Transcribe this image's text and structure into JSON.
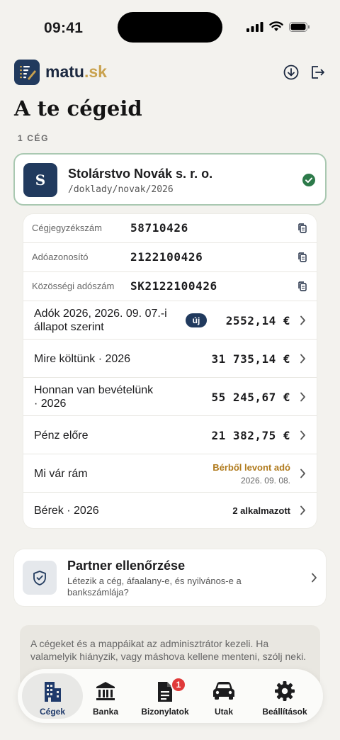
{
  "status_bar": {
    "time": "09:41"
  },
  "app": {
    "brand_name": "matu",
    "brand_tld": ".sk"
  },
  "page": {
    "title": "A te cégeid",
    "count_label": "1 CÉG"
  },
  "company": {
    "initial": "S",
    "name": "Stolárstvo Novák s. r. o.",
    "path": "/doklady/novak/2026",
    "selected": true
  },
  "details": {
    "identifiers": [
      {
        "label": "Cégjegyzékszám",
        "value": "58710426"
      },
      {
        "label": "Adóazonosító",
        "value": "2122100426"
      },
      {
        "label": "Közösségi adószám",
        "value": "SK2122100426"
      }
    ],
    "taxes": {
      "label_line1": "Adók 2026, 2026. 09. 07.-i",
      "label_line2": "állapot szerint",
      "badge": "új",
      "amount": "2552,14 €"
    },
    "spending": {
      "label": "Mire költünk · 2026",
      "amount": "31 735,14 €"
    },
    "income": {
      "label_line1": "Honnan van bevételünk",
      "label_line2": "· 2026",
      "amount": "55 245,67 €"
    },
    "prepaid": {
      "label": "Pénz előre",
      "amount": "21 382,75 €"
    },
    "upcoming": {
      "label": "Mi vár rám",
      "title": "Bérből levont adó",
      "date": "2026. 09. 08."
    },
    "wages": {
      "label": "Bérek · 2026",
      "value": "2 alkalmazott"
    }
  },
  "partner": {
    "title": "Partner ellenőrzése",
    "description": "Létezik a cég, áfaalany-e, és nyilvános-e a bankszámlája?"
  },
  "info": {
    "text": "A cégeket és a mappáikat az adminisztrátor kezeli. Ha valamelyik hiányzik, vagy máshova kellene menteni, szólj neki."
  },
  "tabs": [
    {
      "label": "Cégek",
      "icon": "building-icon",
      "active": true
    },
    {
      "label": "Banka",
      "icon": "bank-icon"
    },
    {
      "label": "Bizonylatok",
      "icon": "document-icon",
      "badge": "1"
    },
    {
      "label": "Utak",
      "icon": "car-icon"
    },
    {
      "label": "Beállítások",
      "icon": "gear-icon"
    }
  ],
  "colors": {
    "brand": "#213a5e",
    "accent": "#c9a24f",
    "success": "#2d7a4a",
    "warning": "#b07a1c",
    "notification": "#e03a3a"
  }
}
